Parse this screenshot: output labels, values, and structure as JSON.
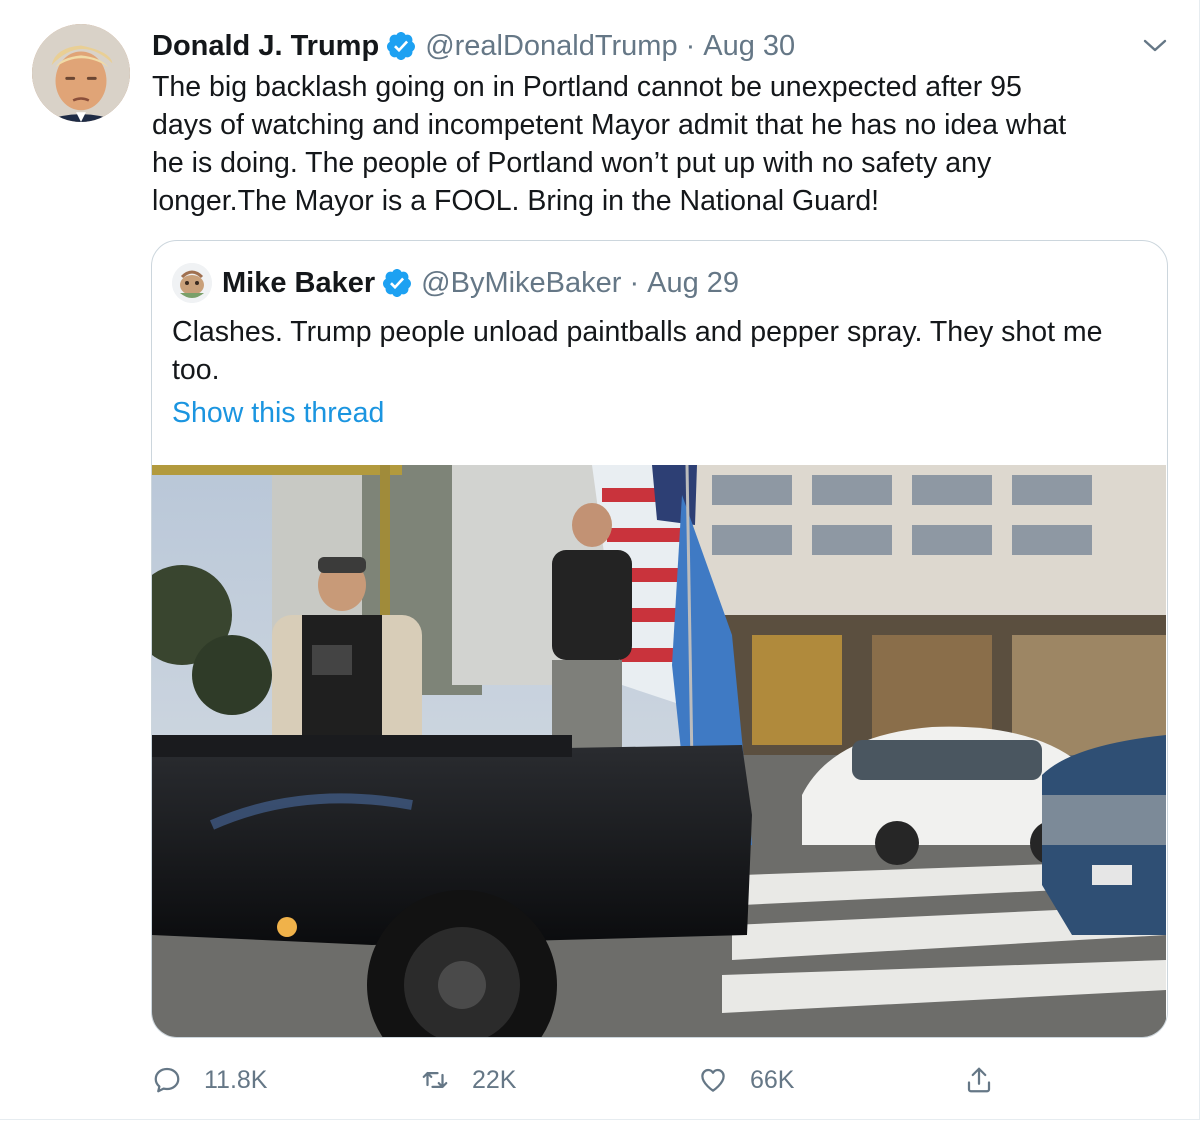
{
  "tweet": {
    "author_name": "Donald J. Trump",
    "author_handle": "@realDonaldTrump",
    "separator": "·",
    "date": "Aug 30",
    "text": "The big backlash going on in Portland cannot be unexpected after 95\ndays of watching and incompetent Mayor admit that he has no idea what\nhe is doing. The people of Portland won’t put up with no safety any\nlonger.The Mayor is a FOOL. Bring in the National Guard!",
    "menu_icon": "chevron-down-icon",
    "verified_icon": "verified-badge-icon"
  },
  "quote": {
    "author_name": "Mike Baker",
    "author_handle": "@ByMikeBaker",
    "separator": "·",
    "date": "Aug 29",
    "text": "Clashes. Trump people unload paintballs and pepper spray. They shot me too.",
    "show_thread": "Show this thread",
    "media_type": "video-thumbnail"
  },
  "actions": {
    "reply_count": "11.8K",
    "retweet_count": "22K",
    "like_count": "66K",
    "reply_icon": "reply-icon",
    "retweet_icon": "retweet-icon",
    "like_icon": "heart-icon",
    "share_icon": "share-icon"
  },
  "colors": {
    "text_primary": "#14171a",
    "text_secondary": "#657786",
    "link_blue": "#1b95e0",
    "verified_blue": "#1da1f2",
    "border": "#ccd6dd"
  }
}
